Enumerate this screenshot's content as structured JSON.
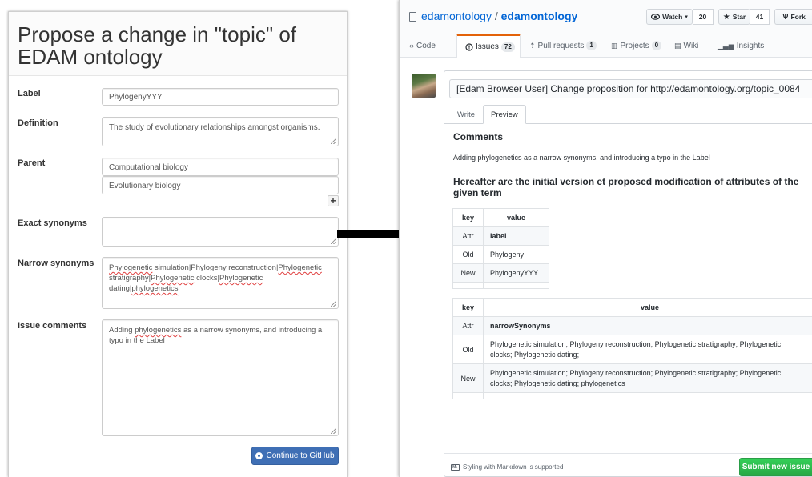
{
  "form": {
    "title": "Propose a change in \"topic\" of EDAM ontology",
    "labels": {
      "label": "Label",
      "definition": "Definition",
      "parent": "Parent",
      "exact_synonyms": "Exact synonyms",
      "narrow_synonyms": "Narrow synonyms",
      "issue_comments": "Issue comments"
    },
    "values": {
      "label": "PhylogenyYYY",
      "definition": "The study of evolutionary relationships amongst organisms.",
      "parent_1": "Computational biology",
      "parent_2": "Evolutionary biology",
      "exact_synonyms": "",
      "narrow_synonyms_parts": [
        "Phylogenetic",
        " simulation|Phylogeny reconstruction|",
        "Phylogenetic",
        " stratigraphy|",
        "Phylogenetic",
        " clocks|",
        "Phylogenetic",
        " dating|",
        "phylogenetics"
      ],
      "issue_comments_parts": [
        "Adding ",
        "phylogenetics",
        " as a narrow synonyms, and introducing a typo in the Label"
      ]
    },
    "add_parent_label": "+",
    "continue_button": "Continue to GitHub"
  },
  "github": {
    "owner": "edamontology",
    "separator": "/",
    "repo": "edamontology",
    "watch_label": "Watch",
    "watch_count": "20",
    "star_label": "Star",
    "star_count": "41",
    "fork_label": "Fork",
    "tabs": [
      {
        "label": "Code",
        "count": ""
      },
      {
        "label": "Issues",
        "count": "72"
      },
      {
        "label": "Pull requests",
        "count": "1"
      },
      {
        "label": "Projects",
        "count": "0"
      },
      {
        "label": "Wiki",
        "count": ""
      },
      {
        "label": "Insights",
        "count": ""
      }
    ],
    "issue_title": "[Edam Browser User] Change proposition for http://edamontology.org/topic_0084",
    "write_tab": "Write",
    "preview_tab": "Preview",
    "preview": {
      "comments_heading": "Comments",
      "comments_text": "Adding phylogenetics as a narrow synonyms, and introducing a typo in the Label",
      "hereafter_heading": "Hereafter are the initial version et proposed modification of attributes of the given term",
      "table1": {
        "headers": [
          "key",
          "value"
        ],
        "rows": [
          [
            "Attr",
            "label"
          ],
          [
            "Old",
            "Phylogeny"
          ],
          [
            "New",
            "PhylogenyYYY"
          ]
        ]
      },
      "table2": {
        "headers": [
          "key",
          "value"
        ],
        "rows": [
          [
            "Attr",
            "narrowSynonyms"
          ],
          [
            "Old",
            "Phylogenetic simulation; Phylogeny reconstruction; Phylogenetic stratigraphy; Phylogenetic clocks; Phylogenetic dating;"
          ],
          [
            "New",
            "Phylogenetic simulation; Phylogeny reconstruction; Phylogenetic stratigraphy; Phylogenetic clocks; Phylogenetic dating; phylogenetics"
          ]
        ]
      }
    },
    "markdown_note": "Styling with Markdown is supported",
    "submit_button": "Submit new issue"
  },
  "colors": {
    "link": "#0366d6",
    "issues_accent": "#e36209",
    "continue_btn": "#3f6fb5",
    "submit_btn": "#28a745"
  }
}
